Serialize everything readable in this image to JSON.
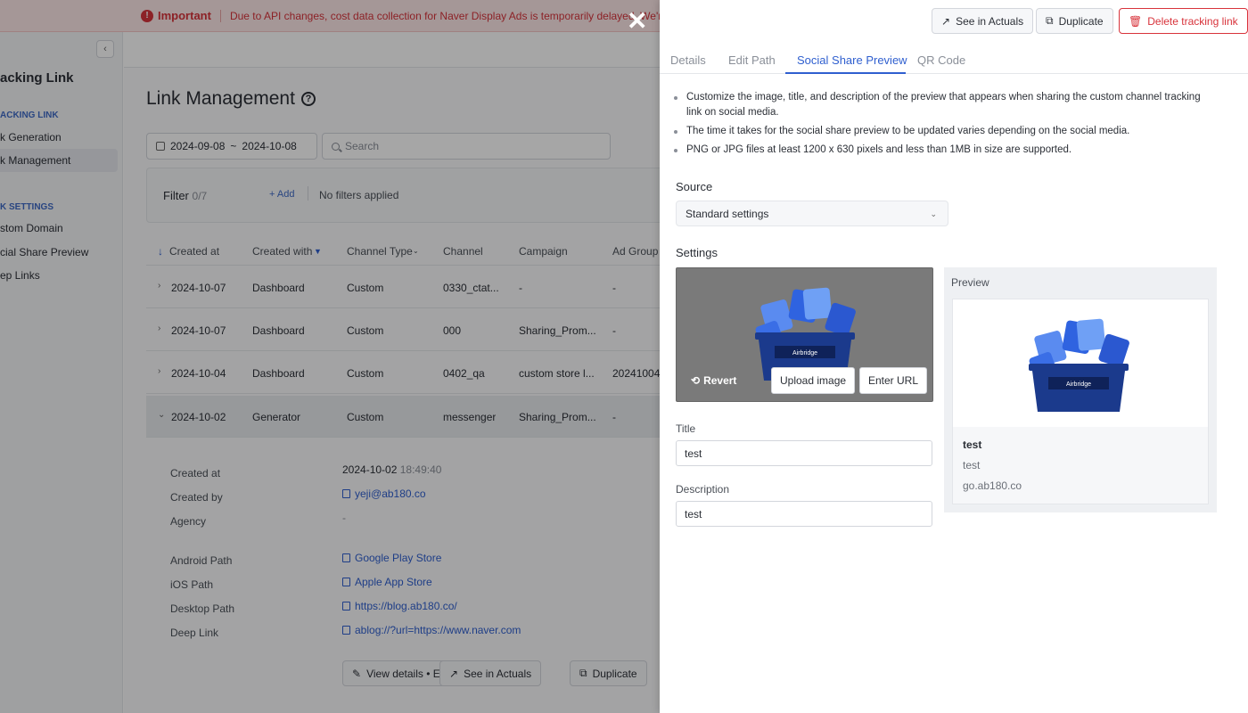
{
  "banner": {
    "label": "Important",
    "message": "Due to API changes, cost data collection for Naver Display Ads is temporarily delayed. We're wo"
  },
  "sidebar": {
    "title": "acking Link",
    "group1": "ACKING LINK",
    "group1_items": [
      "k Generation",
      "k Management"
    ],
    "group2": "K SETTINGS",
    "group2_items": [
      "stom Domain",
      "cial Share Preview",
      "ep Links"
    ]
  },
  "main": {
    "title": "Link Management",
    "date_from": "2024-09-08",
    "date_sep": "~",
    "date_to": "2024-10-08",
    "search_placeholder": "Search",
    "filter_label": "Filter",
    "filter_count": "0/7",
    "filter_add": "+ Add",
    "filter_status": "No filters applied",
    "columns": [
      "Created at",
      "Created with",
      "Channel Type",
      "Channel",
      "Campaign",
      "Ad Group"
    ],
    "rows": [
      {
        "created_at": "2024-10-07",
        "created_with": "Dashboard",
        "channel_type": "Custom",
        "channel": "0330_ctat...",
        "campaign": "-",
        "ad_group": "-"
      },
      {
        "created_at": "2024-10-07",
        "created_with": "Dashboard",
        "channel_type": "Custom",
        "channel": "000",
        "campaign": "Sharing_Prom...",
        "ad_group": "-"
      },
      {
        "created_at": "2024-10-04",
        "created_with": "Dashboard",
        "channel_type": "Custom",
        "channel": "0402_qa",
        "campaign": "custom store l...",
        "ad_group": "20241004"
      },
      {
        "created_at": "2024-10-02",
        "created_with": "Generator",
        "channel_type": "Custom",
        "channel": "messenger",
        "campaign": "Sharing_Prom...",
        "ad_group": "-"
      }
    ],
    "details": {
      "created_at_label": "Created at",
      "created_at_date": "2024-10-02",
      "created_at_time": "18:49:40",
      "created_by_label": "Created by",
      "created_by": "yeji@ab180.co",
      "agency_label": "Agency",
      "agency": "-",
      "android_label": "Android Path",
      "android": "Google Play Store",
      "ios_label": "iOS Path",
      "ios": "Apple App Store",
      "desktop_label": "Desktop Path",
      "desktop": "https://blog.ab180.co/",
      "deeplink_label": "Deep Link",
      "deeplink": "ablog://?url=https://www.naver.com"
    },
    "buttons": {
      "view_details": "View details • Edit",
      "see_actuals": "See in Actuals",
      "duplicate": "Duplicate"
    }
  },
  "drawer": {
    "see_actuals": "See in Actuals",
    "duplicate": "Duplicate",
    "delete": "Delete tracking link",
    "tabs": [
      "Details",
      "Edit Path",
      "Social Share Preview",
      "QR Code"
    ],
    "notes": [
      "Customize the image, title, and description of the preview that appears when sharing the custom channel tracking link on social media.",
      "The time it takes for the social share preview to be updated varies depending on the social media.",
      "PNG or JPG files at least 1200 x 630 pixels and less than 1MB in size are supported."
    ],
    "source_label": "Source",
    "source_value": "Standard settings",
    "settings_label": "Settings",
    "revert": "Revert",
    "upload_image": "Upload image",
    "enter_url": "Enter URL",
    "title_label": "Title",
    "title_value": "test",
    "description_label": "Description",
    "description_value": "test",
    "preview_label": "Preview",
    "preview_title": "test",
    "preview_desc": "test",
    "preview_domain": "go.ab180.co",
    "basket_brand": "Airbridge"
  },
  "colors": {
    "accent": "#2f5fcf",
    "danger": "#d8333b",
    "basket": "#1b3a8c"
  }
}
